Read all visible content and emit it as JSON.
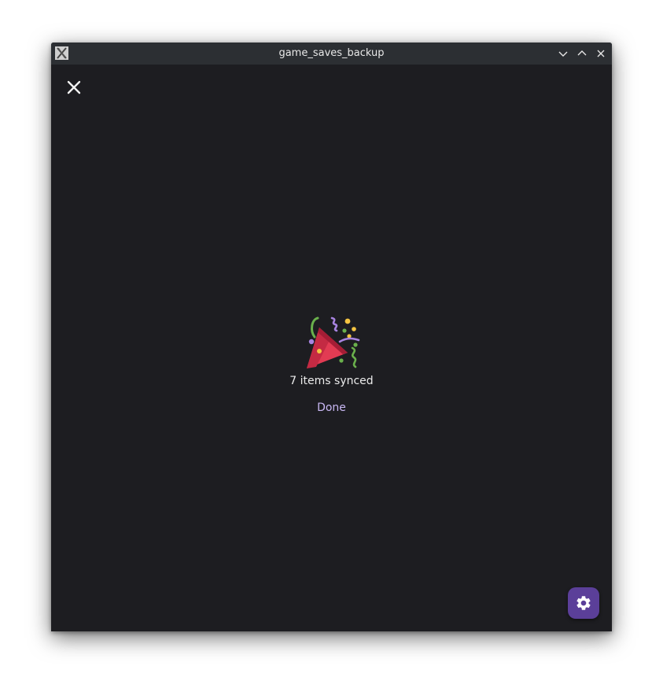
{
  "window": {
    "title": "game_saves_backup"
  },
  "dialog": {
    "status": "7 items synced",
    "done_label": "Done"
  },
  "icons": {
    "app": "x11-app-icon",
    "celebration": "party-popper-icon",
    "close": "close-icon",
    "settings": "gear-icon"
  },
  "colors": {
    "background": "#1d1d21",
    "titlebar": "#2c2f33",
    "accent_text": "#c9b8f4",
    "fab": "#5b3f99"
  }
}
